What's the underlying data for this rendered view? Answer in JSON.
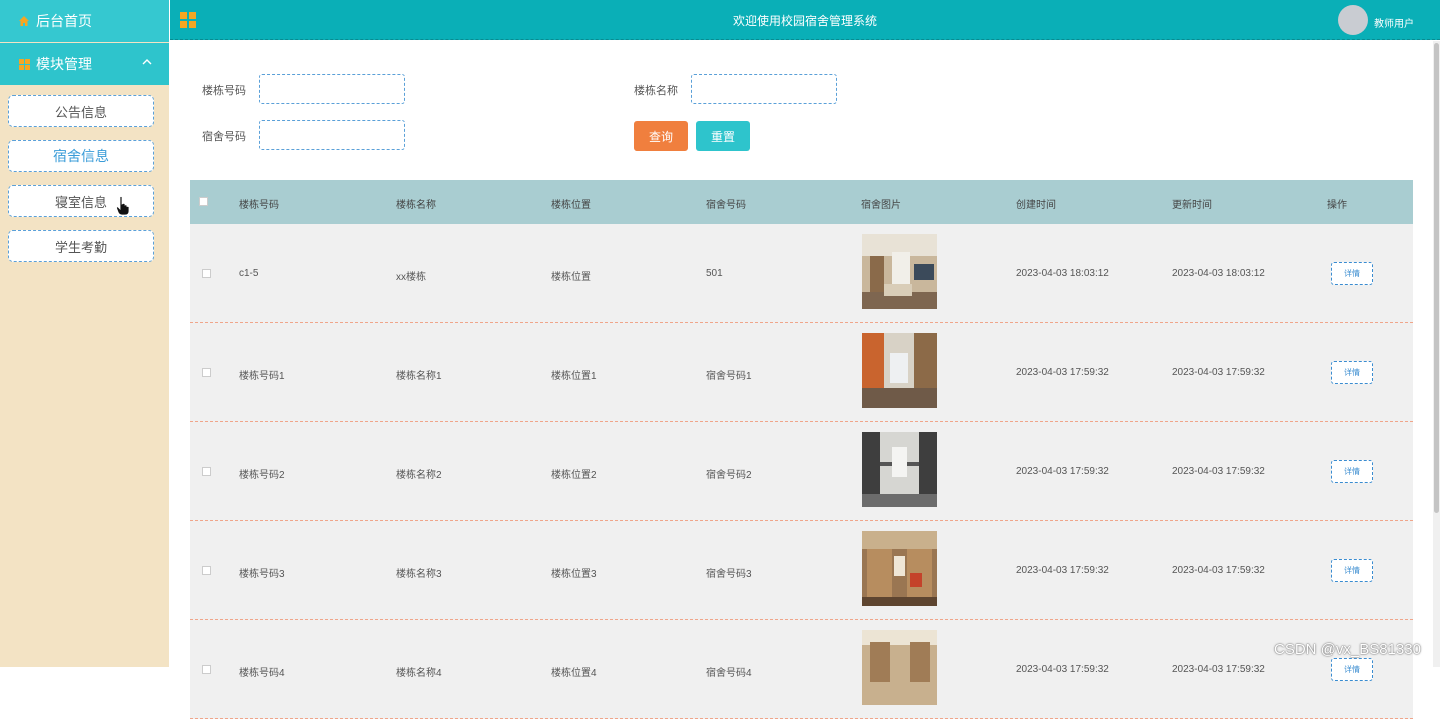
{
  "sidebar": {
    "home_label": "后台首页",
    "home_icon": "home-icon",
    "module_label": "模块管理",
    "module_icon": "grid-icon",
    "items": [
      {
        "label": "公告信息"
      },
      {
        "label": "宿舍信息"
      },
      {
        "label": "寝室信息"
      },
      {
        "label": "学生考勤"
      }
    ]
  },
  "header": {
    "title": "欢迎使用校园宿舍管理系统",
    "user": "教师用户"
  },
  "search": {
    "building_no_label": "楼栋号码",
    "building_name_label": "楼栋名称",
    "dorm_no_label": "宿舍号码",
    "building_no_value": "",
    "building_name_value": "",
    "dorm_no_value": "",
    "query_label": "查询",
    "reset_label": "重置"
  },
  "table": {
    "columns": [
      "楼栋号码",
      "楼栋名称",
      "楼栋位置",
      "宿舍号码",
      "宿舍图片",
      "创建时间",
      "更新时间",
      "操作"
    ],
    "detail_label": "详情",
    "rows": [
      {
        "building_no": "c1-5",
        "building_name": "xx楼栋",
        "location": "楼栋位置",
        "dorm_no": "501",
        "created": "2023-04-03 18:03:12",
        "updated": "2023-04-03 18:03:12",
        "photo": "room-photo-1"
      },
      {
        "building_no": "楼栋号码1",
        "building_name": "楼栋名称1",
        "location": "楼栋位置1",
        "dorm_no": "宿舍号码1",
        "created": "2023-04-03 17:59:32",
        "updated": "2023-04-03 17:59:32",
        "photo": "room-photo-2"
      },
      {
        "building_no": "楼栋号码2",
        "building_name": "楼栋名称2",
        "location": "楼栋位置2",
        "dorm_no": "宿舍号码2",
        "created": "2023-04-03 17:59:32",
        "updated": "2023-04-03 17:59:32",
        "photo": "room-photo-3"
      },
      {
        "building_no": "楼栋号码3",
        "building_name": "楼栋名称3",
        "location": "楼栋位置3",
        "dorm_no": "宿舍号码3",
        "created": "2023-04-03 17:59:32",
        "updated": "2023-04-03 17:59:32",
        "photo": "room-photo-4"
      },
      {
        "building_no": "楼栋号码4",
        "building_name": "楼栋名称4",
        "location": "楼栋位置4",
        "dorm_no": "宿舍号码4",
        "created": "2023-04-03 17:59:32",
        "updated": "2023-04-03 17:59:32",
        "photo": "room-photo-5"
      }
    ]
  },
  "watermark": "CSDN @vx_BS81330",
  "colors": {
    "teal": "#0aafb7",
    "sidebar": "#f3e3c4",
    "orange": "#f07f3e",
    "header_row": "#a9cdd1"
  }
}
